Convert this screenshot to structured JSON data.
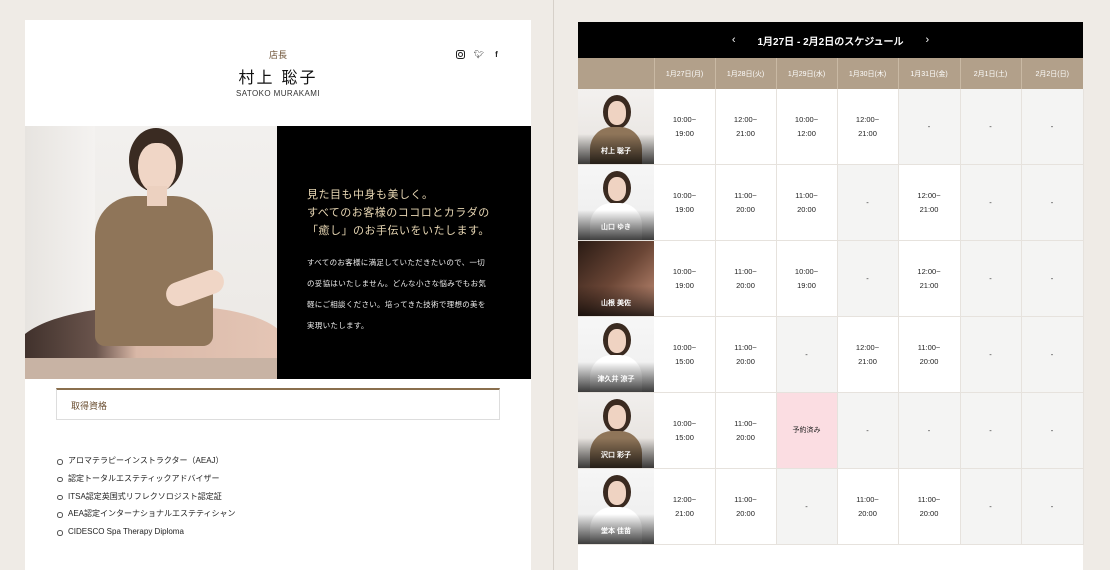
{
  "profile": {
    "role": "店長",
    "name_jp": "村上 聡子",
    "name_en": "SATOKO MURAKAMI",
    "lead": [
      "見た目も中身も美しく。",
      "すべてのお客様のココロとカラダの",
      "「癒し」のお手伝いをいたします。"
    ],
    "description": [
      "すべてのお客様に満足していただきたいので、一切",
      "の妥協はいたしません。どんな小さな悩みでもお気",
      "軽にご相談ください。培ってきた技術で理想の美を",
      "実現いたします。"
    ],
    "qualifications_title": "取得資格",
    "qualifications": [
      "アロマテラピーインストラクター（AEAJ）",
      "認定トータルエステティックアドバイザー",
      "ITSA認定英国式リフレクソロジスト認定証",
      "AEA認定インターナショナルエステティシャン",
      "CIDESCO Spa Therapy Diploma"
    ],
    "social_icons": [
      "instagram-icon",
      "twitter-icon",
      "facebook-icon"
    ]
  },
  "schedule": {
    "title": "1月27日 - 2月2日のスケジュール",
    "prev": "‹",
    "next": "›",
    "days": [
      "1月27日(月)",
      "1月28日(火)",
      "1月29日(水)",
      "1月30日(木)",
      "1月31日(金)",
      "2月1日(土)",
      "2月2日(日)"
    ],
    "staff": [
      {
        "name": "村上 聡子",
        "slots": [
          "10:00~\n19:00",
          "12:00~\n21:00",
          "10:00~\n12:00",
          "12:00~\n21:00",
          "-",
          "-",
          "-"
        ]
      },
      {
        "name": "山口 ゆき",
        "slots": [
          "10:00~\n19:00",
          "11:00~\n20:00",
          "11:00~\n20:00",
          "-",
          "12:00~\n21:00",
          "-",
          "-"
        ]
      },
      {
        "name": "山根 美佐",
        "slots": [
          "10:00~\n19:00",
          "11:00~\n20:00",
          "10:00~\n19:00",
          "-",
          "12:00~\n21:00",
          "-",
          "-"
        ]
      },
      {
        "name": "津久井 涼子",
        "slots": [
          "10:00~\n15:00",
          "11:00~\n20:00",
          "-",
          "12:00~\n21:00",
          "11:00~\n20:00",
          "-",
          "-"
        ]
      },
      {
        "name": "沢口 彩子",
        "slots": [
          "10:00~\n15:00",
          "11:00~\n20:00",
          "予約済み",
          "-",
          "-",
          "-",
          "-"
        ]
      },
      {
        "name": "堂本 佳苗",
        "slots": [
          "12:00~\n21:00",
          "11:00~\n20:00",
          "-",
          "11:00~\n20:00",
          "11:00~\n20:00",
          "-",
          "-"
        ]
      }
    ],
    "colors": {
      "header_bg": "#000000",
      "day_header": "#b2a08a",
      "reserved": "#fbdde2",
      "empty": "#f4f4f3"
    }
  }
}
